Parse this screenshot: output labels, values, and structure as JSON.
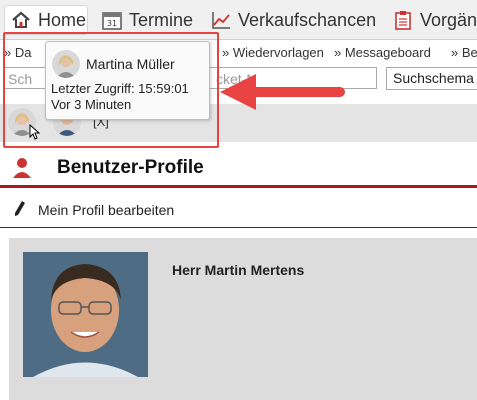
{
  "nav": {
    "items": [
      {
        "label": "Home",
        "icon": "home-icon"
      },
      {
        "label": "Termine",
        "icon": "calendar-icon"
      },
      {
        "label": "Verkaufschancen",
        "icon": "chart-line-icon"
      },
      {
        "label": "Vorgäng",
        "icon": "clipboard-icon"
      }
    ]
  },
  "links": {
    "first": "» Da",
    "wiedervorlagen": "» Wiedervorlagen",
    "messageboard": "» Messageboard",
    "last": "» Be"
  },
  "search": {
    "input_left": "Sch",
    "input_right": "cket-N",
    "schema_label": "Suchschema"
  },
  "userstrip": {
    "close_label": "[X]"
  },
  "tooltip": {
    "name": "Martina Müller",
    "last_access": "Letzter Zugriff: 15:59:01",
    "ago": "Vor 3 Minuten"
  },
  "profile": {
    "title": "Benutzer-Profile",
    "edit_label": "Mein Profil bearbeiten",
    "person_name": "Herr Martin Mertens"
  },
  "colors": {
    "accent_red": "#a61c1c",
    "highlight_red": "#e84242"
  }
}
